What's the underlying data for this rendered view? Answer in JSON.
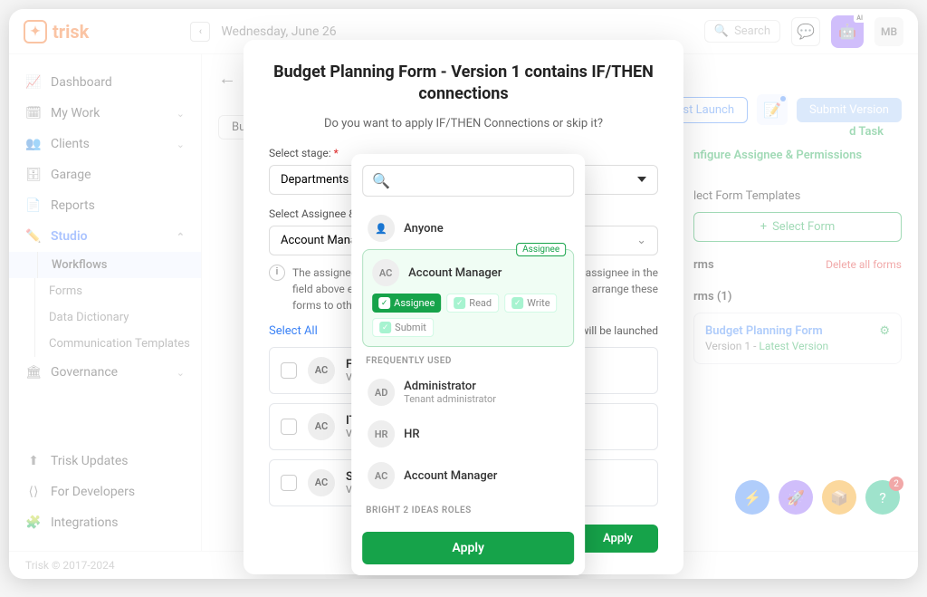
{
  "header": {
    "brand": "trisk",
    "date": "Wednesday, June 26",
    "search_placeholder": "Search",
    "avatar_initials": "MB"
  },
  "sidebar": {
    "items": [
      {
        "label": "Dashboard",
        "expandable": false
      },
      {
        "label": "My Work",
        "expandable": true
      },
      {
        "label": "Clients",
        "expandable": true
      },
      {
        "label": "Garage",
        "expandable": false
      },
      {
        "label": "Reports",
        "expandable": false
      },
      {
        "label": "Studio",
        "expandable": true,
        "active": true
      },
      {
        "label": "Governance",
        "expandable": true
      }
    ],
    "studio_subs": [
      {
        "label": "Workflows",
        "active": true
      },
      {
        "label": "Forms"
      },
      {
        "label": "Data Dictionary"
      },
      {
        "label": "Communication Templates"
      }
    ],
    "bottom": [
      {
        "label": "Trisk Updates"
      },
      {
        "label": "For Developers"
      },
      {
        "label": "Integrations"
      }
    ]
  },
  "main": {
    "chip": "Bud",
    "test_launch": "Test Launch",
    "submit_version": "Submit Version",
    "add_task": "d Task",
    "configure_title": "nfigure Assignee & Permissions",
    "select_form_templates": "lect Form Templates",
    "select_form_btn": "Select Form",
    "forms_header": "rms",
    "forms_count": "rms (1)",
    "delete_all": "Delete all forms",
    "form_card": {
      "title": "Budget Planning Form",
      "version_line": "Version 1 - ",
      "latest": "Latest Version"
    },
    "left": {
      "select_stage_label": "Select stage:",
      "stage_value": "Departments E",
      "assignee_label": "Select Assignee & P",
      "assignee_value": "Account Manag",
      "info_text": "The assignee... field above e... forms to oth...",
      "launch_text": "will be launched",
      "select_all": "Select All",
      "rows": [
        {
          "badge": "AC",
          "title": "Fi",
          "sub": "Ve"
        },
        {
          "badge": "AC",
          "title": "IT",
          "sub": "Ve"
        },
        {
          "badge": "AC",
          "title": "Sa",
          "sub": "Ve"
        }
      ]
    },
    "footer": "Trisk © 2017-2024"
  },
  "modal": {
    "title": "Budget Planning Form - Version 1 contains IF/THEN connections",
    "subtitle": "Do you want to apply IF/THEN Connections or skip it?",
    "select_stage": "Select stage:",
    "stage_value": "Departments E",
    "assignee_perm": "Select Assignee & P",
    "assignee_value": "Account Manag",
    "info_line1": "The assignee",
    "info_line2": "field above e",
    "info_line3": "forms to oth",
    "info_right1": "e assignee in the",
    "info_right2": "arrange these",
    "select_all": "Select All",
    "launch_text": "will be launched",
    "rows": [
      {
        "badge": "AC",
        "t": "Fi",
        "s": "Ve"
      },
      {
        "badge": "AC",
        "t": "IT",
        "s": "Ve"
      },
      {
        "badge": "AC",
        "t": "Sa",
        "s": "Ve"
      }
    ],
    "apply": "Apply"
  },
  "dropdown": {
    "anyone": {
      "label": "Anyone"
    },
    "selected": {
      "badge": "AC",
      "name": "Account Manager",
      "tag": "Assignee",
      "perms": [
        {
          "label": "Assignee",
          "style": "assignee"
        },
        {
          "label": "Read",
          "style": "other"
        },
        {
          "label": "Write",
          "style": "other"
        },
        {
          "label": "Submit",
          "style": "other"
        }
      ]
    },
    "freq_header": "FREQUENTLY USED",
    "freq": [
      {
        "badge": "AD",
        "name": "Administrator",
        "sub": "Tenant administrator"
      },
      {
        "badge": "HR",
        "name": "HR"
      },
      {
        "badge": "AC",
        "name": "Account Manager"
      }
    ],
    "roles_header": "BRIGHT 2 IDEAS ROLES",
    "apply": "Apply"
  }
}
